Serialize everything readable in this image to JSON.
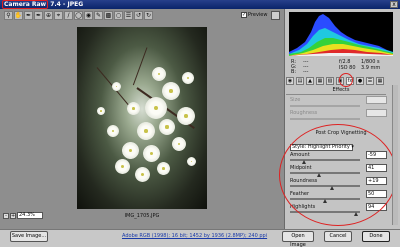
{
  "window": {
    "app": "Camera Raw",
    "version": "7.4",
    "sep": " - ",
    "format": "JPEG",
    "close_label": "x"
  },
  "toolbar": {
    "tools": [
      "zoom-icon",
      "hand-icon",
      "white-balance-icon",
      "color-sampler-icon",
      "target-adjustment-icon",
      "crop-icon",
      "straighten-icon",
      "spot-removal-icon",
      "red-eye-icon",
      "adjustment-brush-icon",
      "graduated-filter-icon",
      "radial-filter-icon",
      "preferences-icon",
      "rotate-ccw-icon",
      "rotate-cw-icon"
    ],
    "preview_label": "Preview",
    "preview_checked": "✓"
  },
  "image": {
    "filename": "IMG_1705.JPG"
  },
  "zoom": {
    "minus": "-",
    "plus": "+",
    "value": "24.3%"
  },
  "readout": {
    "r_label": "R:",
    "g_label": "G:",
    "b_label": "B:",
    "r": "---",
    "g": "---",
    "b": "---",
    "aperture": "f/2.8",
    "shutter": "1/800 s",
    "iso": "ISO 80",
    "focal": "3.9 mm"
  },
  "panel_tabs": [
    "basic-icon",
    "tone-curve-icon",
    "detail-icon",
    "hsl-icon",
    "split-tone-icon",
    "lens-icon",
    "fx-icon",
    "camera-calibration-icon",
    "presets-icon",
    "snapshots-icon"
  ],
  "effects": {
    "title": "Effects",
    "grain_size_label": "Size",
    "grain_roughness_label": "Roughness",
    "vignette_title": "Post Crop Vignetting",
    "style_label": "Style:",
    "style_value": "Highlight Priority",
    "sliders": [
      {
        "label": "Amount",
        "value": "-59",
        "pos": 0.2
      },
      {
        "label": "Midpoint",
        "value": "41",
        "pos": 0.41
      },
      {
        "label": "Roundness",
        "value": "+19",
        "pos": 0.6
      },
      {
        "label": "Feather",
        "value": "50",
        "pos": 0.5
      },
      {
        "label": "Highlights",
        "value": "94",
        "pos": 0.94
      }
    ]
  },
  "bottom": {
    "save_label": "Save Image...",
    "workflow": "Adobe RGB (1998); 16 bit; 1452 by 1936 (2.8MP); 240 ppi",
    "open_label": "Open Image",
    "cancel_label": "Cancel",
    "done_label": "Done"
  },
  "colors": {
    "accent_circle": "#dd2222",
    "titlebar": "#0a246a"
  }
}
